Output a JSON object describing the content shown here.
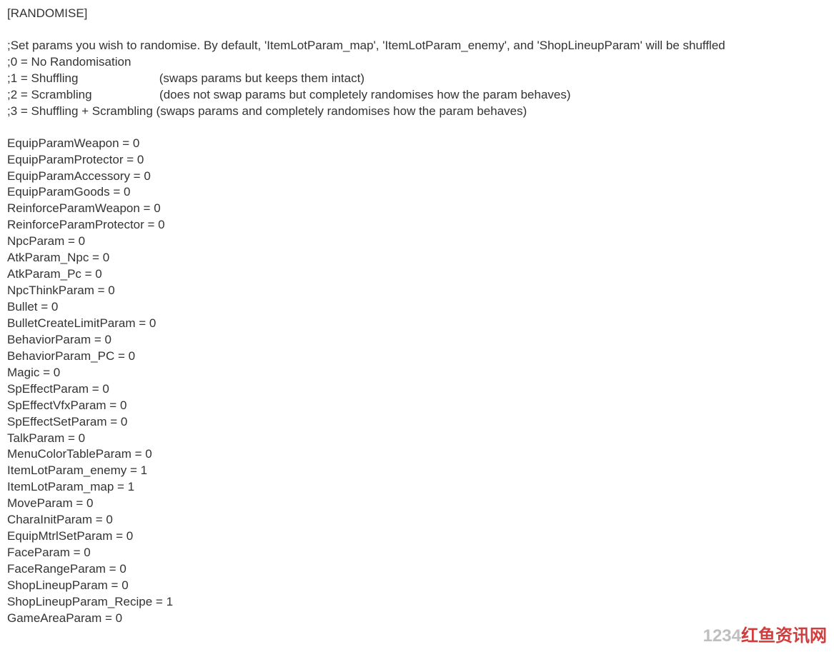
{
  "section_header": "[RANDOMISE]",
  "comments": {
    "intro": ";Set params you wish to randomise. By default, 'ItemLotParam_map', 'ItemLotParam_enemy', and 'ShopLineupParam' will be shuffled",
    "mode0": ";0 = No Randomisation",
    "mode1": ";1 = Shuffling                        (swaps params but keeps them intact)",
    "mode2": ";2 = Scrambling                    (does not swap params but completely randomises how the param behaves)",
    "mode3": ";3 = Shuffling + Scrambling (swaps params and completely randomises how the param behaves)"
  },
  "params": [
    {
      "key": "EquipParamWeapon",
      "value": 0
    },
    {
      "key": "EquipParamProtector",
      "value": 0
    },
    {
      "key": "EquipParamAccessory",
      "value": 0
    },
    {
      "key": "EquipParamGoods",
      "value": 0
    },
    {
      "key": "ReinforceParamWeapon",
      "value": 0
    },
    {
      "key": "ReinforceParamProtector",
      "value": 0
    },
    {
      "key": "NpcParam",
      "value": 0
    },
    {
      "key": "AtkParam_Npc",
      "value": 0
    },
    {
      "key": "AtkParam_Pc",
      "value": 0
    },
    {
      "key": "NpcThinkParam",
      "value": 0
    },
    {
      "key": "Bullet",
      "value": 0
    },
    {
      "key": "BulletCreateLimitParam",
      "value": 0
    },
    {
      "key": "BehaviorParam",
      "value": 0
    },
    {
      "key": "BehaviorParam_PC",
      "value": 0
    },
    {
      "key": "Magic",
      "value": 0
    },
    {
      "key": "SpEffectParam",
      "value": 0
    },
    {
      "key": "SpEffectVfxParam",
      "value": 0
    },
    {
      "key": "SpEffectSetParam",
      "value": 0
    },
    {
      "key": "TalkParam",
      "value": 0
    },
    {
      "key": "MenuColorTableParam",
      "value": 0
    },
    {
      "key": "ItemLotParam_enemy",
      "value": 1
    },
    {
      "key": "ItemLotParam_map",
      "value": 1
    },
    {
      "key": "MoveParam",
      "value": 0
    },
    {
      "key": "CharaInitParam",
      "value": 0
    },
    {
      "key": "EquipMtrlSetParam",
      "value": 0
    },
    {
      "key": "FaceParam",
      "value": 0
    },
    {
      "key": "FaceRangeParam",
      "value": 0
    },
    {
      "key": "ShopLineupParam",
      "value": 0
    },
    {
      "key": "ShopLineupParam_Recipe",
      "value": 1
    },
    {
      "key": "GameAreaParam",
      "value": 0
    }
  ],
  "watermark": {
    "grey": "1234",
    "red": "红鱼资讯网"
  }
}
